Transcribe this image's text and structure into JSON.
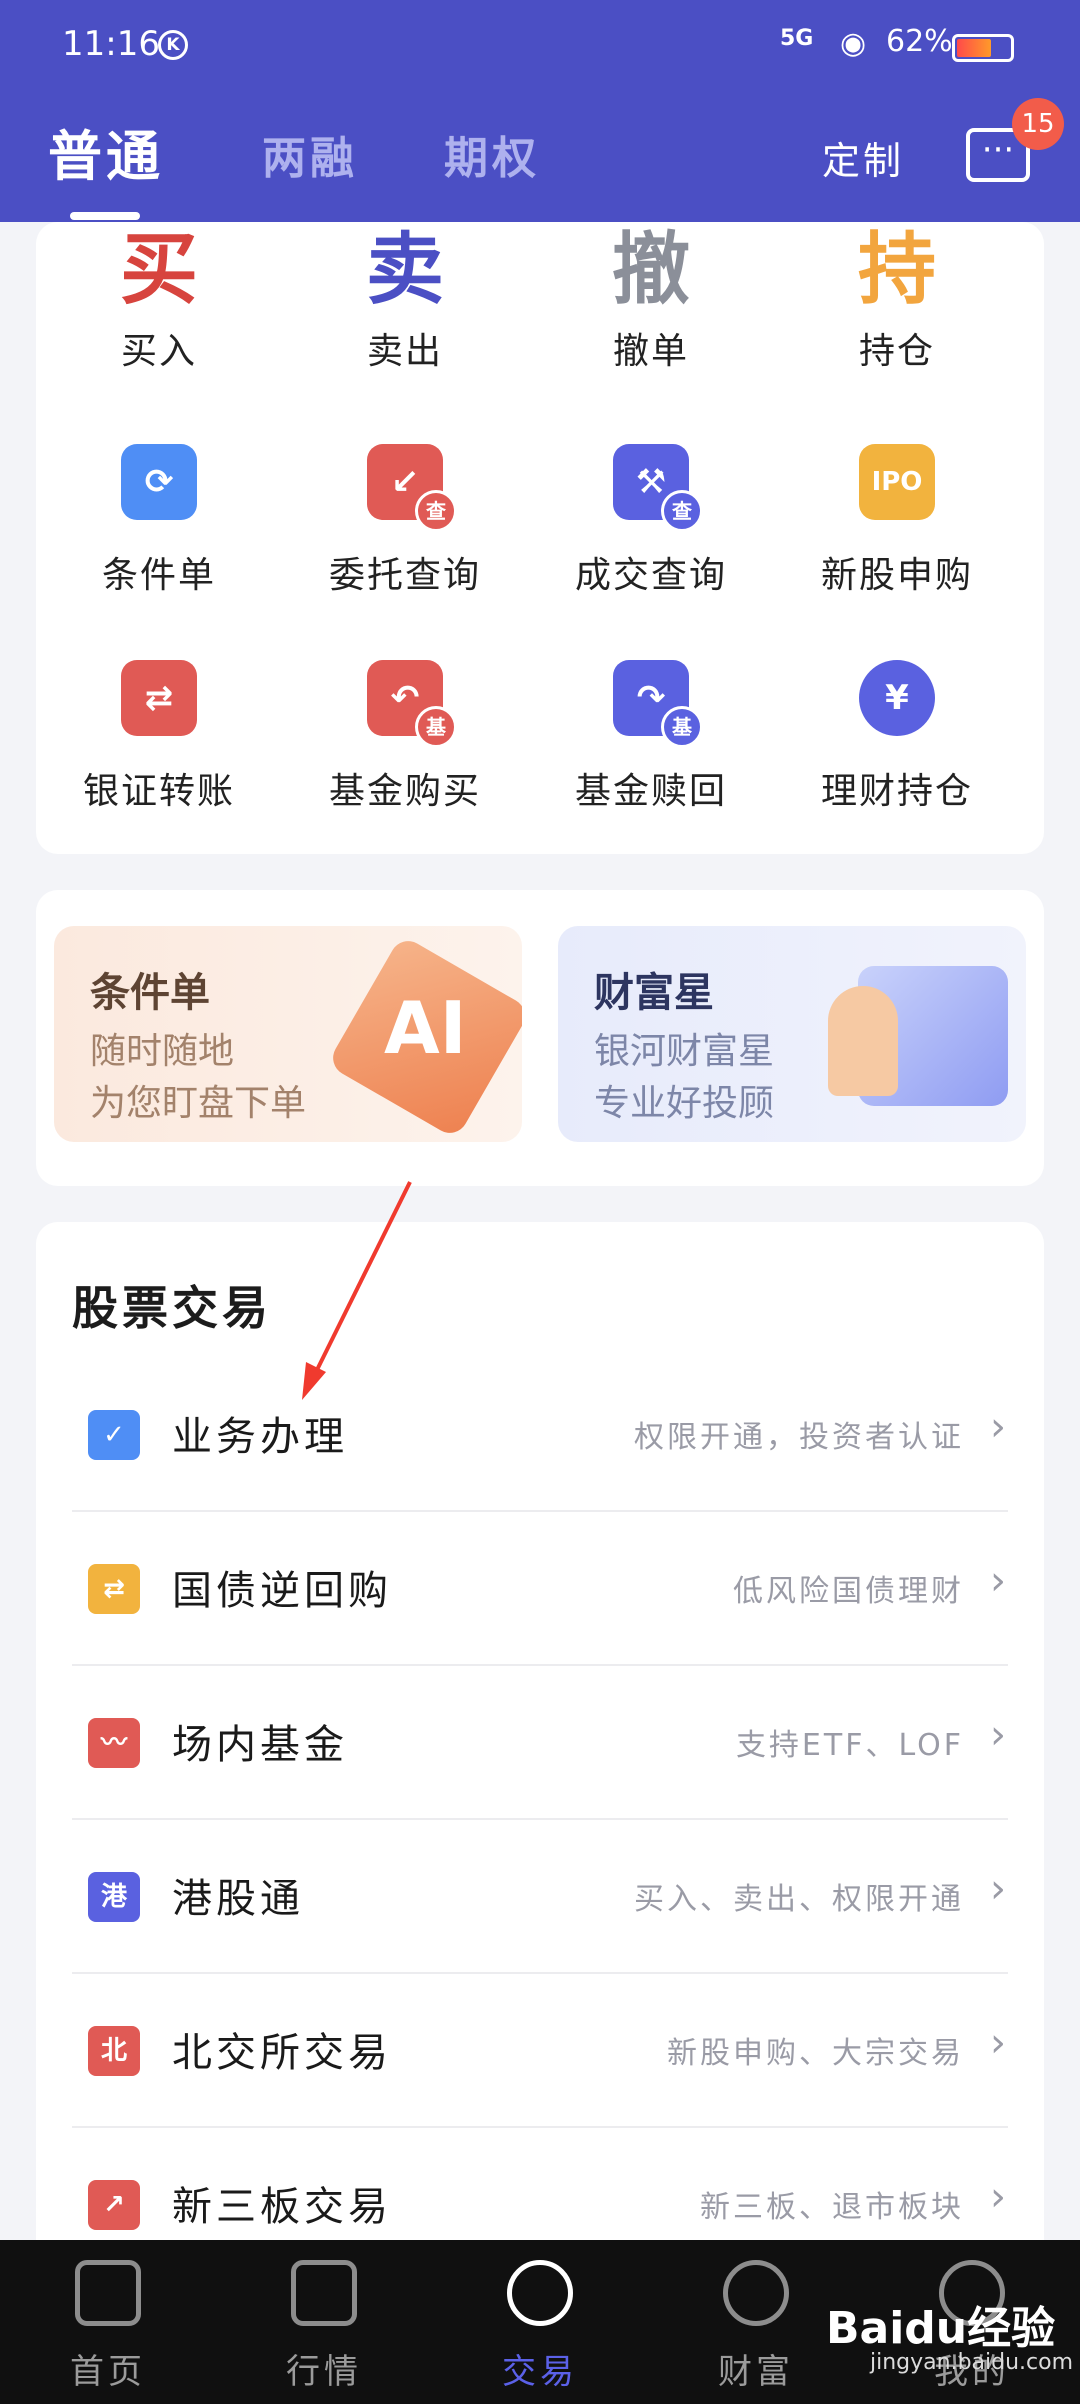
{
  "status_bar": {
    "time": "11:16",
    "k_icon": "K",
    "network": "5G",
    "battery": "62%"
  },
  "header": {
    "tabs": [
      {
        "label": "普通"
      },
      {
        "label": "两融"
      },
      {
        "label": "期权"
      }
    ],
    "custom_label": "定制",
    "message_badge": "15"
  },
  "quick_trade": [
    {
      "char": "买",
      "label": "买入",
      "color": "#d7443e"
    },
    {
      "char": "卖",
      "label": "卖出",
      "color": "#4b4fc4"
    },
    {
      "char": "撤",
      "label": "撤单",
      "color": "#8b8f99"
    },
    {
      "char": "持",
      "label": "持仓",
      "color": "#f2a53e"
    }
  ],
  "services": [
    {
      "label": "条件单",
      "icon": "condition-icon",
      "glyph": "⟳",
      "sub": ""
    },
    {
      "label": "委托查询",
      "icon": "order-query-icon",
      "glyph": "↙",
      "sub": "查"
    },
    {
      "label": "成交查询",
      "icon": "deal-query-icon",
      "glyph": "⚒",
      "sub": "查"
    },
    {
      "label": "新股申购",
      "icon": "ipo-icon",
      "glyph": "IPO",
      "sub": ""
    },
    {
      "label": "银证转账",
      "icon": "transfer-icon",
      "glyph": "⇄",
      "sub": ""
    },
    {
      "label": "基金购买",
      "icon": "fund-buy-icon",
      "glyph": "↶",
      "sub": "基"
    },
    {
      "label": "基金赎回",
      "icon": "fund-redeem-icon",
      "glyph": "↷",
      "sub": "基"
    },
    {
      "label": "理财持仓",
      "icon": "wealth-holding-icon",
      "glyph": "¥",
      "sub": ""
    }
  ],
  "promos": [
    {
      "title": "条件单",
      "line1": "随时随地",
      "line2": "为您盯盘下单",
      "art": "AI"
    },
    {
      "title": "财富星",
      "line1": "银河财富星",
      "line2": "专业好投顾"
    }
  ],
  "stock_trading": {
    "title": "股票交易",
    "rows": [
      {
        "label": "业务办理",
        "desc": "权限开通，投资者认证",
        "icon": "business-icon",
        "glyph": "✓",
        "color": "#4f8ef5"
      },
      {
        "label": "国债逆回购",
        "desc": "低风险国债理财",
        "icon": "repo-icon",
        "glyph": "⇄",
        "color": "#f2b33e"
      },
      {
        "label": "场内基金",
        "desc": "支持ETF、LOF",
        "icon": "exchange-fund-icon",
        "glyph": "〰",
        "color": "#e05a55"
      },
      {
        "label": "港股通",
        "desc": "买入、卖出、权限开通",
        "icon": "hk-connect-icon",
        "glyph": "港",
        "color": "#5a61e0"
      },
      {
        "label": "北交所交易",
        "desc": "新股申购、大宗交易",
        "icon": "bse-icon",
        "glyph": "北",
        "color": "#e05a55"
      },
      {
        "label": "新三板交易",
        "desc": "新三板、退市板块",
        "icon": "neeq-icon",
        "glyph": "↗",
        "color": "#e05a55"
      }
    ]
  },
  "bottom_nav": [
    {
      "label": "首页",
      "icon": "home-icon"
    },
    {
      "label": "行情",
      "icon": "market-icon"
    },
    {
      "label": "交易",
      "icon": "trade-icon"
    },
    {
      "label": "财富",
      "icon": "wealth-icon"
    },
    {
      "label": "我的",
      "icon": "profile-icon"
    }
  ],
  "watermark": {
    "logo": "Baidu经验",
    "url": "jingyan.baidu.com"
  }
}
